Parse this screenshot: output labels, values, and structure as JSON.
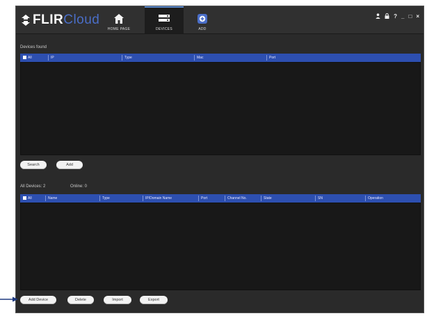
{
  "app": {
    "logo_flir": "FLIR",
    "logo_cloud": "Cloud",
    "nav_tabs": [
      {
        "label": "HOME PAGE",
        "icon": "home-icon"
      },
      {
        "label": "DEVICES",
        "icon": "devices-icon",
        "active": true
      },
      {
        "label": "ADD",
        "icon": "add-icon"
      }
    ],
    "window_controls": [
      "user-icon",
      "lock-icon",
      "help-icon",
      "minimize-icon",
      "maximize-icon",
      "close-icon"
    ],
    "window_control_glyphs": {
      "help": "?",
      "minimize": "_",
      "maximize": "□",
      "close": "×"
    }
  },
  "devices_found": {
    "label": "Devices found",
    "columns": [
      "All",
      "IP",
      "Type",
      "Mac",
      "Port"
    ],
    "rows": []
  },
  "found_actions": {
    "search": "Search",
    "add": "Add"
  },
  "all_devices": {
    "label": "All Devices: 2",
    "online_label": "Online: 0",
    "columns": [
      "All",
      "Name",
      "Type",
      "IP/Domain Name",
      "Port",
      "Channel No.",
      "State",
      "SN",
      "Operation"
    ],
    "rows": []
  },
  "device_actions": {
    "add_device": "Add Device",
    "delete": "Delete",
    "import": "Import",
    "export": "Export"
  },
  "colors": {
    "header_blue": "#2d4fb0",
    "accent_blue": "#4a6ec8",
    "background": "#2a2a2a",
    "grid_body": "#181818"
  }
}
